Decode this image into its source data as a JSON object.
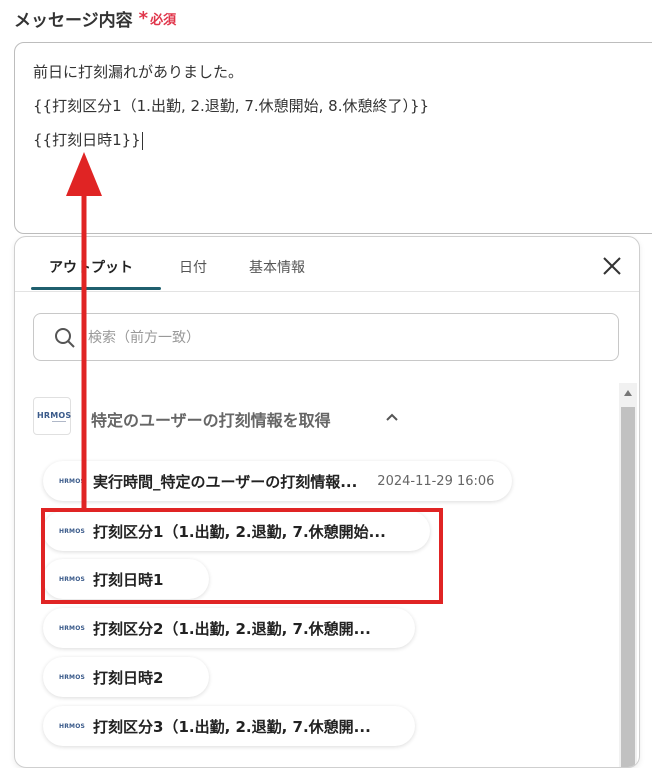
{
  "field": {
    "label": "メッセージ内容",
    "required_mark": "*",
    "required_text": "必須"
  },
  "message": {
    "lines": [
      "前日に打刻漏れがありました。",
      "{{打刻区分1（1.出勤, 2.退勤, 7.休憩開始, 8.休憩終了）}}",
      "{{打刻日時1}}"
    ]
  },
  "panel": {
    "tabs": [
      "アウトプット",
      "日付",
      "基本情報"
    ],
    "active_tab": "アウトプット",
    "search": {
      "placeholder": "検索（前方一致）",
      "value": ""
    },
    "group": {
      "logo_text": "HRMOS",
      "title": "特定のユーザーの打刻情報を取得"
    },
    "items": [
      {
        "label": "実行時間_特定のユーザーの打刻情報...",
        "value": "2024-11-29 16:06"
      },
      {
        "label": "打刻区分1（1.出勤, 2.退勤, 7.休憩開始...",
        "value": ""
      },
      {
        "label": "打刻日時1",
        "value": ""
      },
      {
        "label": "打刻区分2（1.出勤, 2.退勤, 7.休憩開...",
        "value": ""
      },
      {
        "label": "打刻日時2",
        "value": ""
      },
      {
        "label": "打刻区分3（1.出勤, 2.退勤, 7.休憩開...",
        "value": ""
      }
    ]
  },
  "colors": {
    "accent_tab": "#1f5f6e",
    "required": "#e0364b",
    "annotation": "#e02424"
  }
}
